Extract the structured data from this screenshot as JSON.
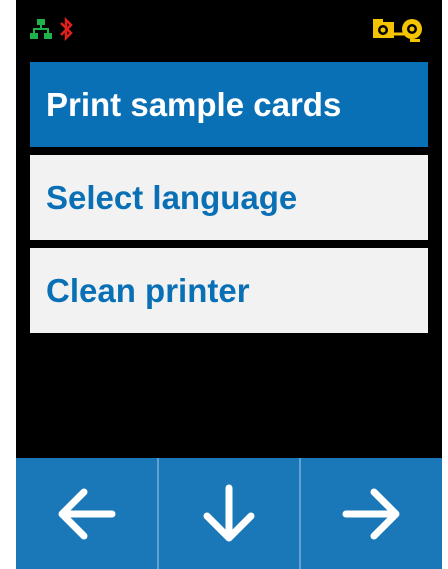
{
  "status_bar": {
    "icons": [
      "network-icon",
      "bluetooth-icon",
      "ribbon-icon"
    ],
    "colors": {
      "network": "#1fb24a",
      "bluetooth": "#e0201b",
      "ribbon": "#f5c400"
    }
  },
  "menu": {
    "items": [
      {
        "label": "Print sample cards",
        "selected": true
      },
      {
        "label": "Select language",
        "selected": false
      },
      {
        "label": "Clean printer",
        "selected": false
      }
    ]
  },
  "nav": {
    "buttons": [
      {
        "icon": "arrow-left-icon"
      },
      {
        "icon": "arrow-down-icon"
      },
      {
        "icon": "arrow-right-icon"
      }
    ]
  },
  "colors": {
    "accent": "#0a70b6",
    "item_bg": "#f2f2f2",
    "nav_bg": "#1a78b8",
    "screen_bg": "#000000"
  }
}
